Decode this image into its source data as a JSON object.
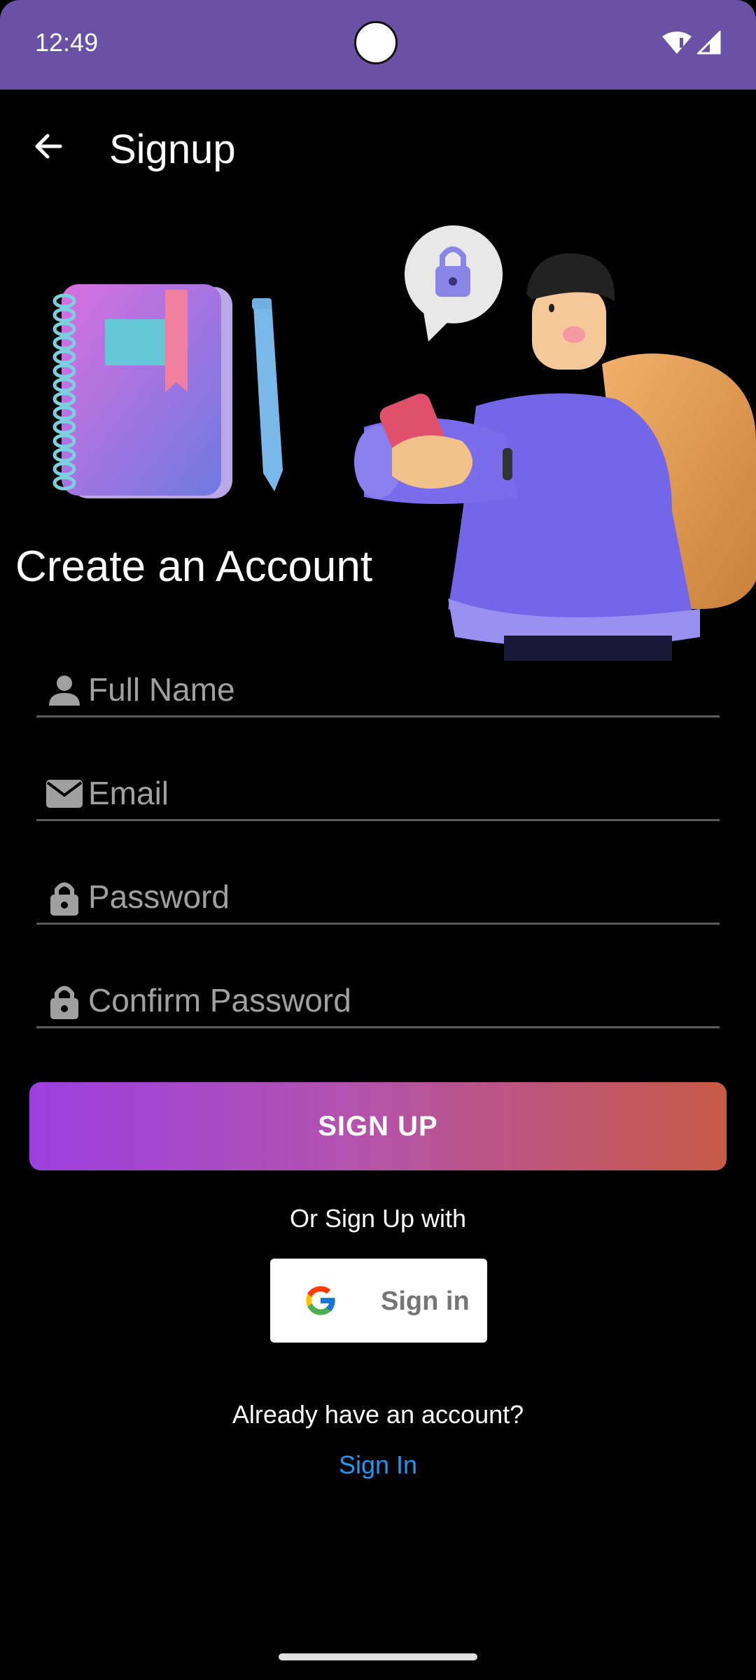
{
  "status_bar": {
    "time": "12:49"
  },
  "app_bar": {
    "title": "Signup"
  },
  "headline": "Create an Account",
  "fields": {
    "full_name": {
      "placeholder": "Full Name",
      "icon": "person-icon"
    },
    "email": {
      "placeholder": "Email",
      "icon": "mail-icon"
    },
    "password": {
      "placeholder": "Password",
      "icon": "lock-icon"
    },
    "confirm_password": {
      "placeholder": "Confirm Password",
      "icon": "lock-icon"
    }
  },
  "signup_button": {
    "label": "SIGN UP"
  },
  "or_text": "Or Sign Up with",
  "google_button": {
    "label": "Sign in",
    "icon": "google-icon"
  },
  "footer": {
    "prompt": "Already have an account?",
    "link": "Sign In"
  },
  "colors": {
    "status_bar": "#6a51a6",
    "background": "#000000",
    "gradient_start": "#9b3fe0",
    "gradient_end": "#c85a46",
    "link": "#2196f3"
  }
}
